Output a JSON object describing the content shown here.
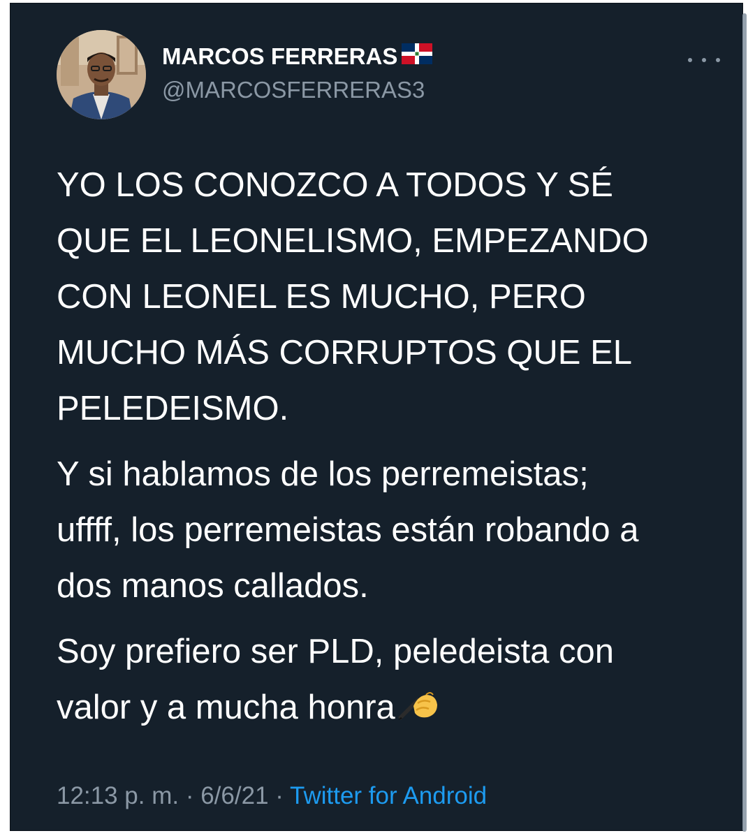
{
  "tweet": {
    "author": {
      "display_name": "MARCOS FERRERAS",
      "flag_icon": "dominican-republic-flag",
      "handle": "@MARCOSFERRERAS3"
    },
    "paragraphs": [
      "YO LOS CONOZCO A TODOS Y SÉ\nQUE EL LEONELISMO, EMPEZANDO\nCON LEONEL ES MUCHO, PERO\nMUCHO MÁS CORRUPTOS QUE EL\nPELEDEISMO.",
      "Y si hablamos de los perremeistas;\nuffff, los perremeistas están robando a\ndos manos callados.",
      "Soy prefiero ser PLD, peledeista con\nvalor y a mucha honra"
    ],
    "trailing_emoji": "writing-hand-emoji",
    "time": "12:13 p. m.",
    "separator": " · ",
    "date": "6/6/21",
    "source": "Twitter for Android"
  },
  "colors": {
    "background": "#15202b",
    "text": "#ffffff",
    "secondary": "#8b98a5",
    "link": "#1d9bf0"
  }
}
